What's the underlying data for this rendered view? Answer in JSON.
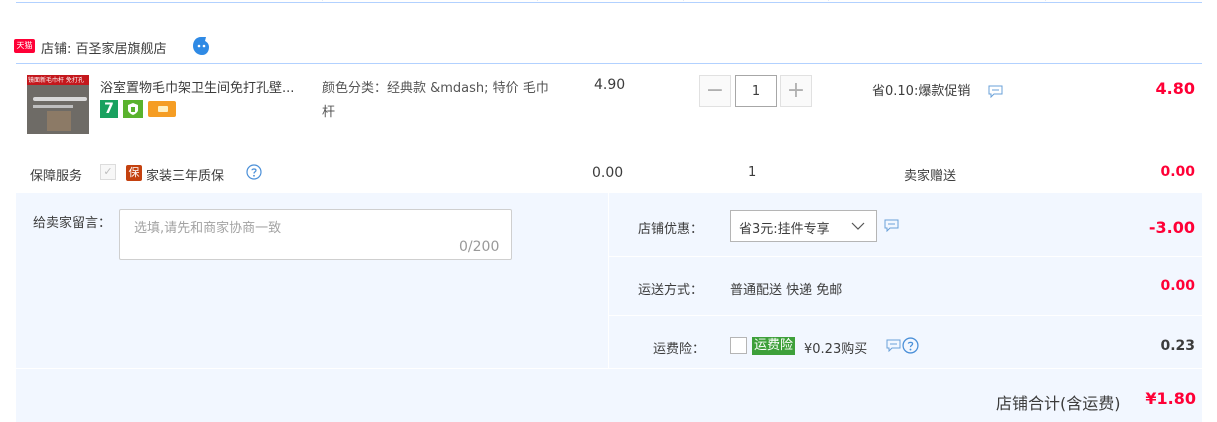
{
  "shop": {
    "logo_text": "天猫",
    "label": "店铺: 百圣家居旗舰店"
  },
  "item": {
    "thumb_text": "镜面新毛巾杆   免打孔",
    "title": "浴室置物毛巾架卫生间免打孔壁...",
    "badge_seven": "7",
    "sku": "颜色分类：经典款 &mdash; 特价 毛巾杆",
    "price": "4.90",
    "qty_minus": "−",
    "qty_value": "1",
    "qty_plus": "+",
    "promo": "省0.10:爆款促销",
    "subtotal": "4.80"
  },
  "service": {
    "label": "保障服务",
    "check_mark": "✓",
    "bao_text": "保",
    "name": "家装三年质保",
    "price": "0.00",
    "qty": "1",
    "gift": "卖家赠送",
    "subtotal": "0.00"
  },
  "memo": {
    "label": "给卖家留言：",
    "placeholder": "选填,请先和商家协商一致",
    "count": "0/200"
  },
  "coupon": {
    "label": "店铺优惠：",
    "selected": "省3元:挂件专享",
    "discount": "-3.00"
  },
  "shipping": {
    "label": "运送方式：",
    "value": "普通配送 快递 免邮",
    "fee": "0.00"
  },
  "insurance": {
    "label": "运费险：",
    "badge": "运费险",
    "text": "¥0.23购买",
    "fee": "0.23"
  },
  "total": {
    "label": "店铺合计(含运费)",
    "value": "¥1.80"
  },
  "colors": {
    "accent_red": "#ff0036",
    "panel_bg": "#f2f7ff",
    "divider_blue": "#b2d1ff",
    "insurance_green": "#3ea03a"
  }
}
